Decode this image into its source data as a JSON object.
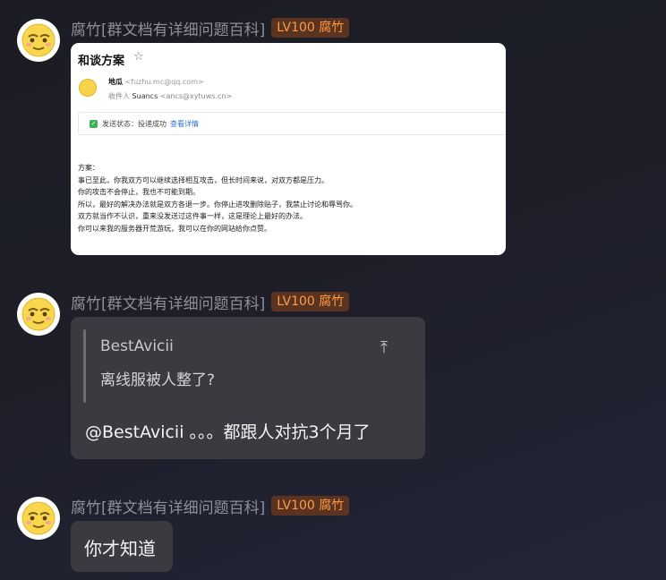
{
  "messages": [
    {
      "sender": "腐竹[群文档有详细问题百科]",
      "badge": "LV100 腐竹",
      "email": {
        "subject": "和谈方案",
        "star_icon": "star-outline-icon",
        "from_name": "地瓜",
        "from_addr": "<fuzhu.mc@qq.com>",
        "to_label": "收件人",
        "to_name": "Suancs",
        "to_addr": "<ancs@xytuws.cn>",
        "status_label": "发送状态：投递成功",
        "status_link": "查看详情",
        "body_lines": [
          "方案：",
          "事已至此，你我双方可以继续选择相互攻击，但长时间来说，对双方都是压力。",
          "你的攻击不会停止，我也不可能到期。",
          "所以，最好的解决办法就是双方各退一步。你停止进攻删除贴子，我禁止讨论和辱骂你。",
          "双方就当作不认识，重来没发送过这件事一样，这是理论上最好的办法。",
          "你可以来我的服务器开荒游玩，我可以在你的网站给你点赞。"
        ]
      }
    },
    {
      "sender": "腐竹[群文档有详细问题百科]",
      "badge": "LV100 腐竹",
      "quote": {
        "name": "BestAvicii",
        "text": "离线服被人整了?",
        "icon": "jump-to-top-icon"
      },
      "text": "@BestAvicii 。。。都跟人对抗3个月了"
    },
    {
      "sender": "腐竹[群文档有详细问题百科]",
      "badge": "LV100 腐竹",
      "text": "你才知道"
    }
  ],
  "colors": {
    "badge_text": "#ff9a45",
    "badge_bg": "#5a3420",
    "bubble_bg": "#3a3a40",
    "sender_text": "#8e8f99"
  }
}
